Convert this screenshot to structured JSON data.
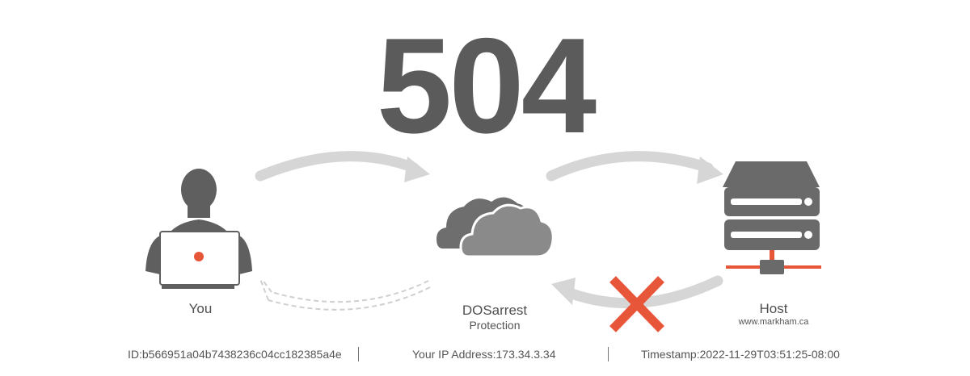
{
  "error": {
    "code": "504"
  },
  "nodes": {
    "you": {
      "label": "You",
      "icon": "user-laptop-icon"
    },
    "dosarrest": {
      "label": "DOSarrest",
      "sublabel": "Protection",
      "icon": "cloud-icon"
    },
    "host": {
      "label": "Host",
      "sublabel": "www.markham.ca",
      "icon": "server-icon"
    }
  },
  "footer": {
    "id_text": "ID:b566951a04b7438236c04cc182385a4e",
    "ip_text": "Your IP Address:173.34.3.34",
    "timestamp_text": "Timestamp:2022-11-29T03:51:25-08:00"
  },
  "colors": {
    "text": "#5b5b5b",
    "icon": "#5f5f5f",
    "arrow": "#d6d6d6",
    "accent": "#e8563a"
  }
}
